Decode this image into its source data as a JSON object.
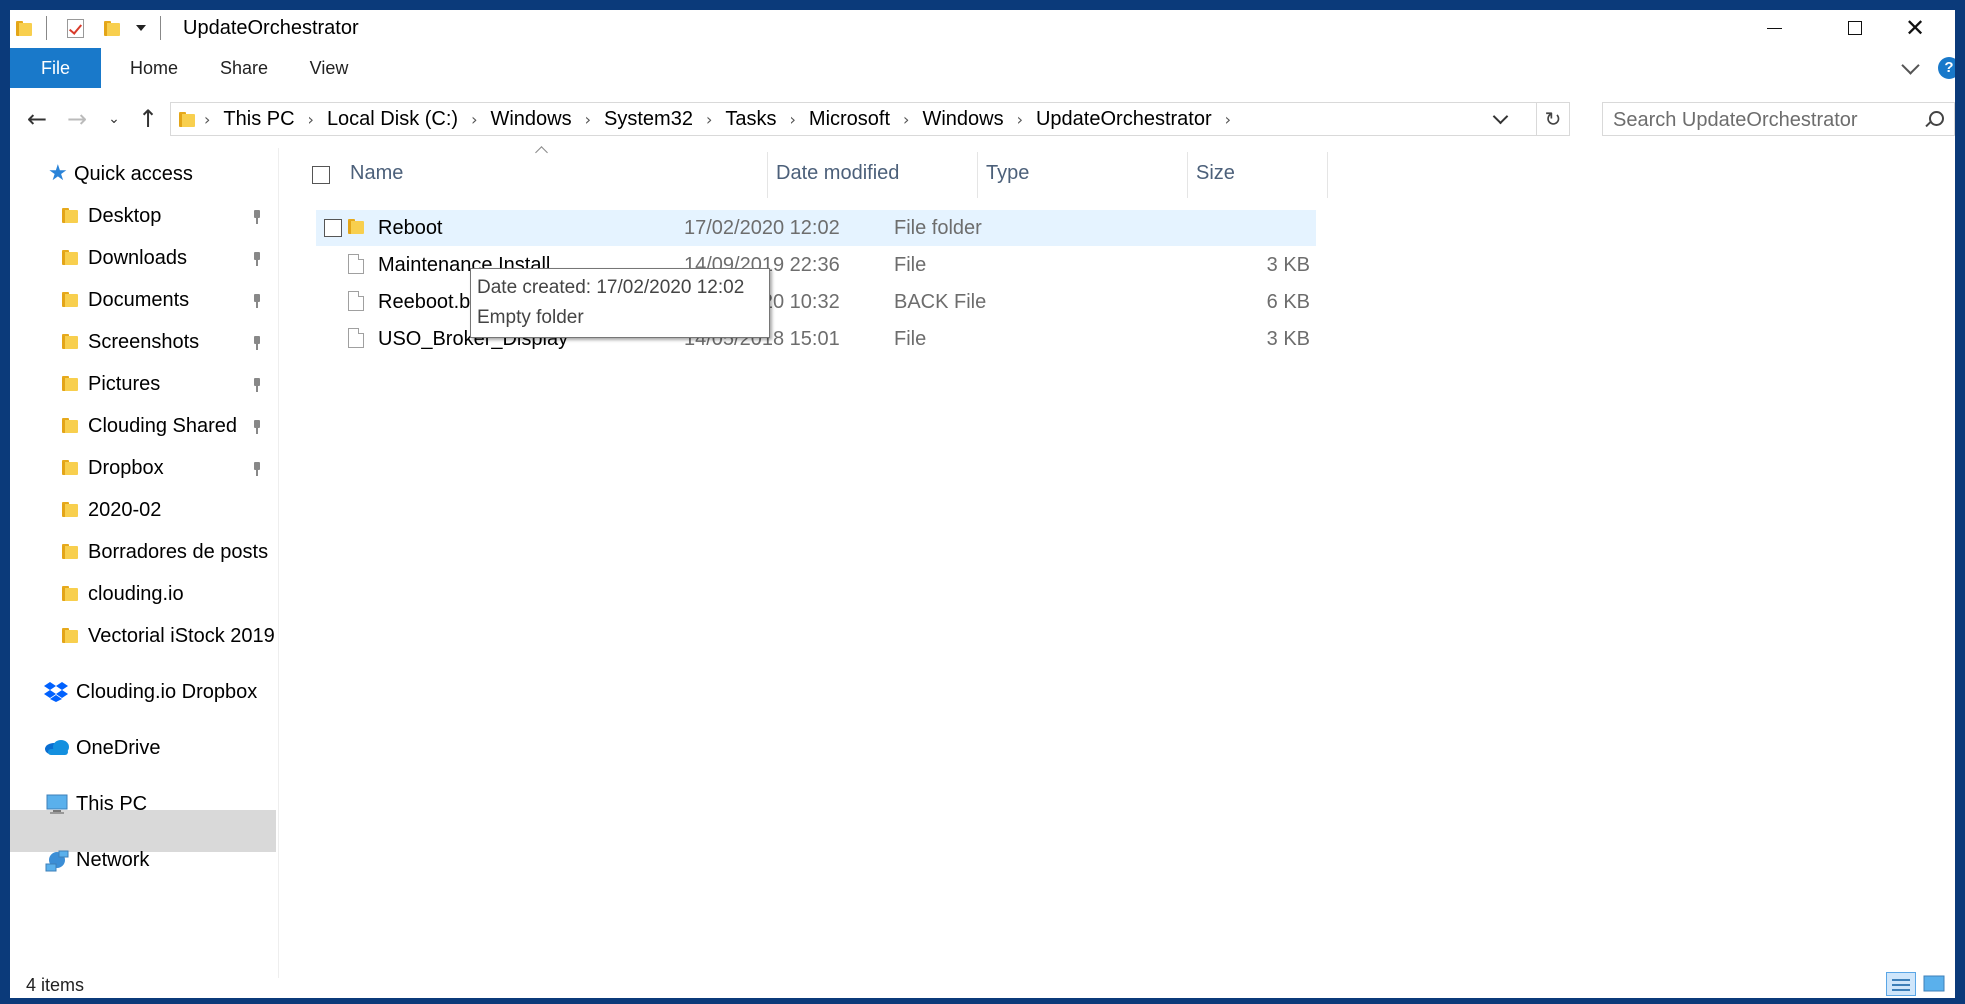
{
  "window": {
    "title": "UpdateOrchestrator",
    "controls": [
      "minimize",
      "maximize",
      "close"
    ]
  },
  "ribbon": {
    "tabs": [
      {
        "label": "File",
        "active": true
      },
      {
        "label": "Home"
      },
      {
        "label": "Share"
      },
      {
        "label": "View"
      }
    ],
    "accent": "#1979ca"
  },
  "address": {
    "crumbs": [
      "This PC",
      "Local Disk (C:)",
      "Windows",
      "System32",
      "Tasks",
      "Microsoft",
      "Windows",
      "UpdateOrchestrator"
    ]
  },
  "search": {
    "placeholder": "Search UpdateOrchestrator"
  },
  "sidebar": {
    "quick_access": "Quick access",
    "pinned": [
      {
        "label": "Desktop",
        "icon": "desktop-folder-icon",
        "pinned": true
      },
      {
        "label": "Downloads",
        "icon": "downloads-folder-icon",
        "pinned": true
      },
      {
        "label": "Documents",
        "icon": "documents-folder-icon",
        "pinned": true
      },
      {
        "label": "Screenshots",
        "icon": "folder-icon",
        "pinned": true
      },
      {
        "label": "Pictures",
        "icon": "pictures-folder-icon",
        "pinned": true
      },
      {
        "label": "Clouding Shared",
        "icon": "shared-folder-icon",
        "pinned": true
      },
      {
        "label": "Dropbox",
        "icon": "dropbox-folder-icon",
        "pinned": true
      },
      {
        "label": "2020-02",
        "icon": "folder-icon"
      },
      {
        "label": "Borradores de posts",
        "icon": "folder-icon"
      },
      {
        "label": "clouding.io",
        "icon": "folder-icon"
      },
      {
        "label": "Vectorial iStock 2019",
        "icon": "folder-icon"
      }
    ],
    "roots": [
      {
        "label": "Clouding.io Dropbox",
        "icon": "dropbox-icon"
      },
      {
        "label": "OneDrive",
        "icon": "onedrive-icon"
      },
      {
        "label": "This PC",
        "icon": "this-pc-icon",
        "selected": true
      },
      {
        "label": "Network",
        "icon": "network-icon"
      }
    ]
  },
  "columns": {
    "name": "Name",
    "date": "Date modified",
    "type": "Type",
    "size": "Size"
  },
  "files": [
    {
      "name": "Reboot",
      "date": "17/02/2020 12:02",
      "type": "File folder",
      "size": "",
      "icon": "folder-icon",
      "selected": true
    },
    {
      "name": "Maintenance Install",
      "date": "14/09/2019 22:36",
      "type": "File",
      "size": "3 KB",
      "icon": "file-icon"
    },
    {
      "name": "Reeboot.bak",
      "date": "17/02/2020 10:32",
      "type": "BACK File",
      "size": "6 KB",
      "icon": "file-icon"
    },
    {
      "name": "USO_Broker_Display",
      "date": "14/05/2018 15:01",
      "type": "File",
      "size": "3 KB",
      "icon": "file-icon"
    }
  ],
  "tooltip": {
    "line1": "Date created: 17/02/2020 12:02",
    "line2": "Empty folder"
  },
  "status": {
    "count": "4 items"
  }
}
